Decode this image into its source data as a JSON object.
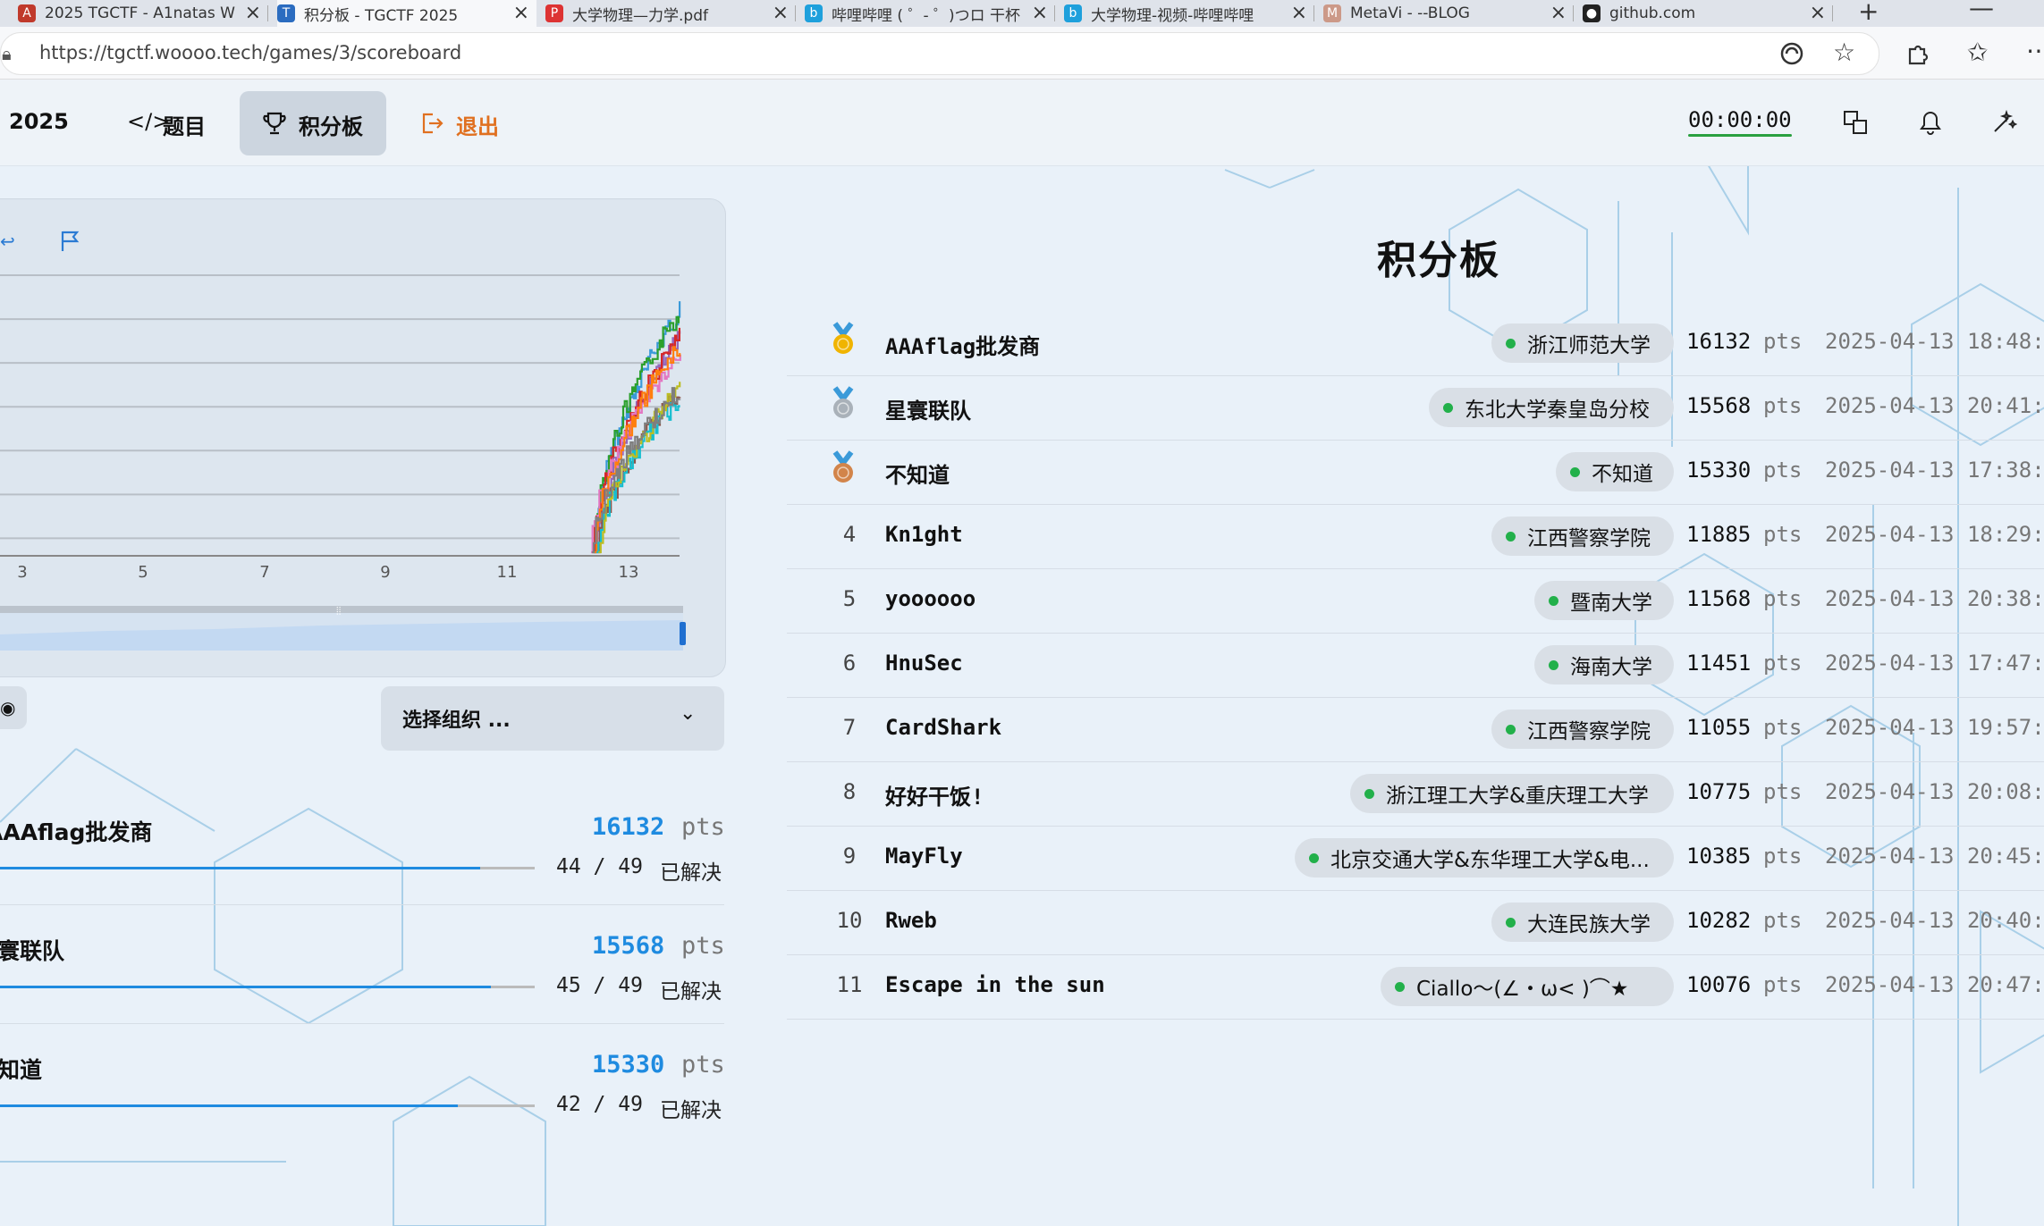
{
  "browser": {
    "tabs": [
      {
        "label": "2025 TGCTF - A1natas W",
        "icon": "ctf-icon",
        "color": "#c0392b"
      },
      {
        "label": "积分板 - TGCTF 2025",
        "icon": "ctf-icon",
        "color": "#2b6cc0",
        "active": true
      },
      {
        "label": "大学物理—力学.pdf",
        "icon": "pdf-icon",
        "color": "#d33"
      },
      {
        "label": "哔哩哔哩 ( ゜- ゜)つロ 干杯",
        "icon": "bilibili-icon",
        "color": "#1ea0dc"
      },
      {
        "label": "大学物理-视频-哔哩哔哩",
        "icon": "bilibili-icon",
        "color": "#1ea0dc"
      },
      {
        "label": "MetaVi - --BLOG",
        "icon": "blog-icon",
        "color": "#c98"
      },
      {
        "label": "github.com",
        "icon": "github-icon",
        "color": "#222"
      }
    ],
    "url": "https://tgctf.woooo.tech/games/3/scoreboard"
  },
  "header": {
    "game_year": "2025",
    "nav_challenges": "题目",
    "nav_scoreboard": "积分板",
    "nav_logout": "退出",
    "timer": "00:00:00"
  },
  "chart_data": {
    "type": "line",
    "x_tick_labels": [
      "3",
      "5",
      "7",
      "9",
      "11",
      "13"
    ],
    "xlim": [
      1,
      14
    ],
    "series_colors": [
      "#3a9ad9",
      "#2ca02c",
      "#9467bd",
      "#d62728",
      "#e377c2",
      "#ff7f0e",
      "#8c564b",
      "#17becf",
      "#bcbd22",
      "#7f7f7f"
    ],
    "note_visible": "ten team score lines rising sharply from about day 12.5 to 13.8"
  },
  "left_panel": {
    "org_select_label": "选择组织 ...",
    "pts_label": "pts",
    "solved_suffix": "已解决",
    "teams": [
      {
        "name": "AAAflag批发商",
        "score": "16132",
        "solved": "44 / 49",
        "fraction": 0.898
      },
      {
        "name": "星寰联队",
        "score": "15568",
        "solved": "45 / 49",
        "fraction": 0.918
      },
      {
        "name": "不知道",
        "score": "15330",
        "solved": "42 / 49",
        "fraction": 0.857
      }
    ]
  },
  "scoreboard": {
    "title": "积分板",
    "pts_label": "pts",
    "rows": [
      {
        "rank": "1",
        "name": "AAAflag批发商",
        "org": "浙江师范大学",
        "score": "16132",
        "time": "2025-04-13 18:48:"
      },
      {
        "rank": "2",
        "name": "星寰联队",
        "org": "东北大学秦皇岛分校",
        "score": "15568",
        "time": "2025-04-13 20:41:"
      },
      {
        "rank": "3",
        "name": "不知道",
        "org": "不知道",
        "score": "15330",
        "time": "2025-04-13 17:38:"
      },
      {
        "rank": "4",
        "name": "Kn1ght",
        "org": "江西警察学院",
        "score": "11885",
        "time": "2025-04-13 18:29:"
      },
      {
        "rank": "5",
        "name": "yoooooo",
        "org": "暨南大学",
        "score": "11568",
        "time": "2025-04-13 20:38:"
      },
      {
        "rank": "6",
        "name": "HnuSec",
        "org": "海南大学",
        "score": "11451",
        "time": "2025-04-13 17:47:"
      },
      {
        "rank": "7",
        "name": "CardShark",
        "org": "江西警察学院",
        "score": "11055",
        "time": "2025-04-13 19:57:"
      },
      {
        "rank": "8",
        "name": "好好干饭!",
        "org": "浙江理工大学&重庆理工大学",
        "score": "10775",
        "time": "2025-04-13 20:08:"
      },
      {
        "rank": "9",
        "name": "MayFly",
        "org": "北京交通大学&东华理工大学&电...",
        "score": "10385",
        "time": "2025-04-13 20:45:"
      },
      {
        "rank": "10",
        "name": "Rweb",
        "org": "大连民族大学",
        "score": "10282",
        "time": "2025-04-13 20:40:"
      },
      {
        "rank": "11",
        "name": "Escape in the sun",
        "org": "Ciallo～(∠・ω< )⌒★",
        "score": "10076",
        "time": "2025-04-13 20:47:"
      }
    ]
  }
}
